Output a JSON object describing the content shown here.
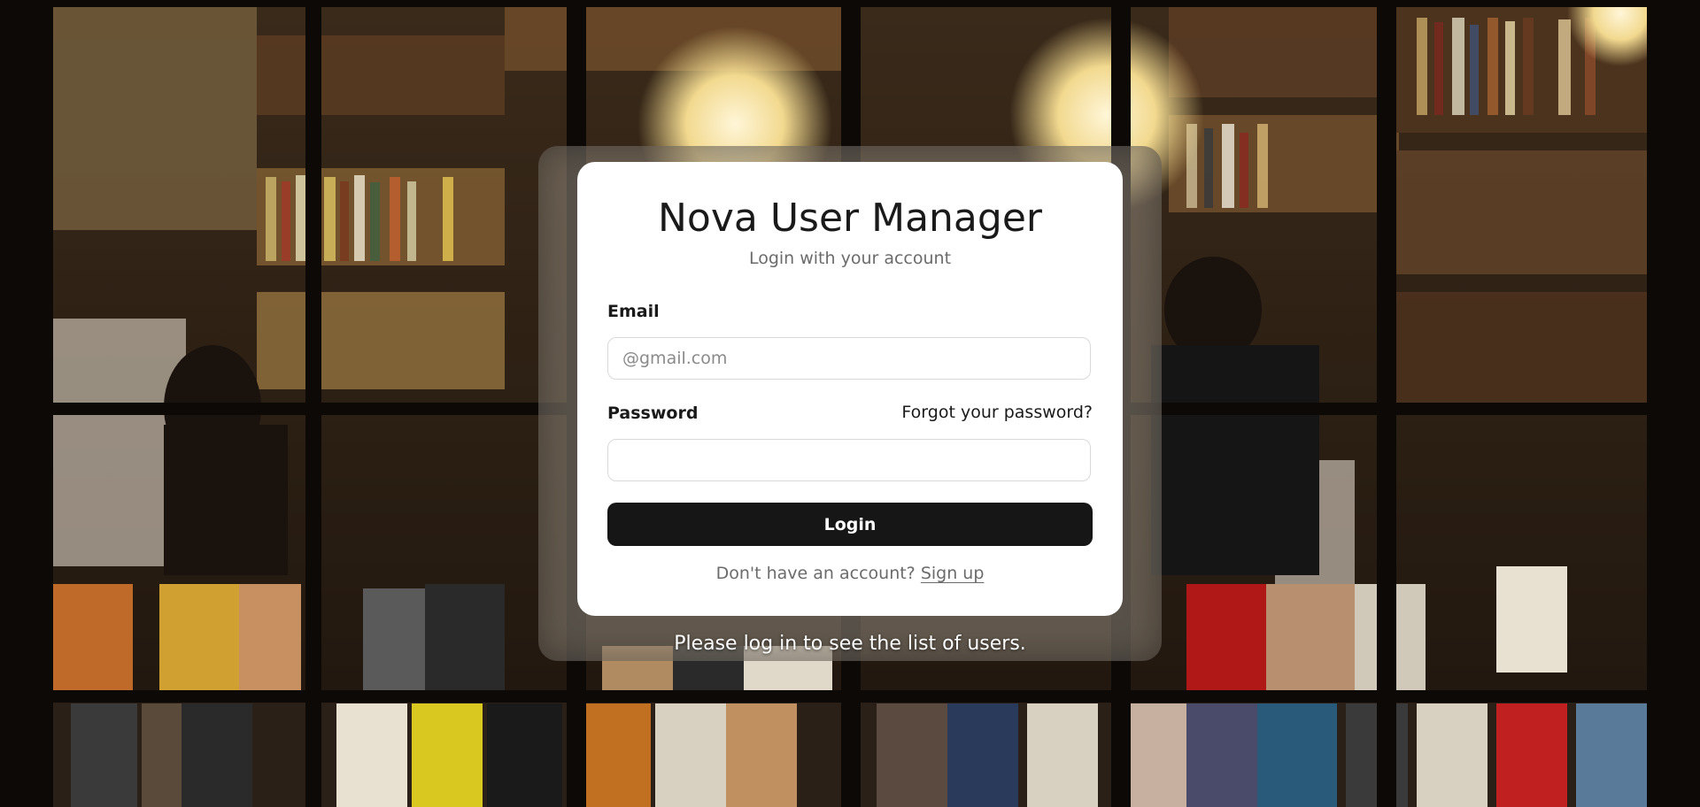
{
  "login": {
    "title": "Nova User Manager",
    "subtitle": "Login with your account",
    "email_label": "Email",
    "email_placeholder": "@gmail.com",
    "email_value": "",
    "password_label": "Password",
    "password_value": "",
    "forgot_link": "Forgot your password?",
    "login_button": "Login",
    "signup_prompt": "Don't have an account?",
    "signup_link": "Sign up"
  },
  "footer_message": "Please log in to see the list of users.",
  "colors": {
    "button_bg": "#161616",
    "card_bg": "#ffffff",
    "muted_text": "#6b6b6b"
  }
}
